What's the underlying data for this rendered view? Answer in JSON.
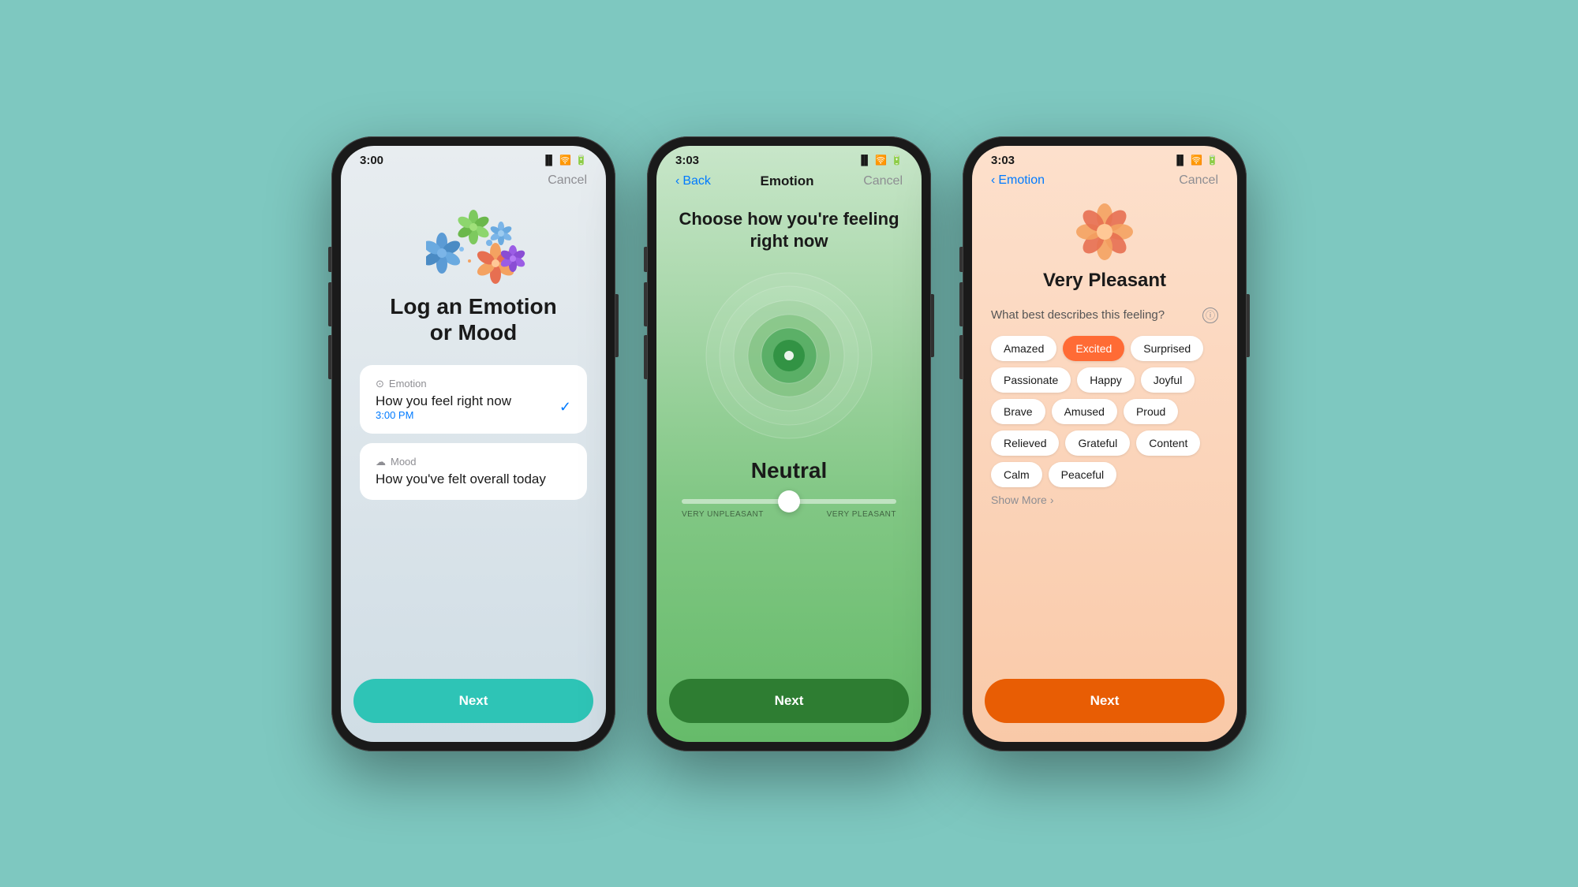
{
  "background": "#7ec8c0",
  "phone1": {
    "status": {
      "time": "3:00",
      "location": "▲",
      "battery": "74"
    },
    "nav": {
      "cancel": "Cancel"
    },
    "flowers": [
      "blue",
      "green",
      "orange-light",
      "blue-light",
      "orange",
      "purple"
    ],
    "title": "Log an Emotion\nor Mood",
    "options": [
      {
        "icon": "⊙",
        "type": "Emotion",
        "description": "How you feel right now",
        "time": "3:00 PM",
        "selected": true
      },
      {
        "icon": "☁",
        "type": "Mood",
        "description": "How you've felt overall today",
        "time": null,
        "selected": false
      }
    ],
    "next_label": "Next"
  },
  "phone2": {
    "status": {
      "time": "3:03",
      "location": "▲",
      "battery": "74"
    },
    "nav": {
      "back": "Back",
      "title": "Emotion",
      "cancel": "Cancel"
    },
    "title": "Choose how you're feeling\nright now",
    "emotion_label": "Neutral",
    "slider": {
      "left_label": "VERY UNPLEASANT",
      "right_label": "VERY PLEASANT",
      "position": 50
    },
    "next_label": "Next"
  },
  "phone3": {
    "status": {
      "time": "3:03",
      "location": "▲",
      "battery": "74"
    },
    "nav": {
      "back": "Emotion",
      "cancel": "Cancel"
    },
    "pleasant_level": "Very Pleasant",
    "describes_label": "What best describes this feeling?",
    "tags": [
      {
        "label": "Amazed",
        "selected": false
      },
      {
        "label": "Excited",
        "selected": true
      },
      {
        "label": "Surprised",
        "selected": false
      },
      {
        "label": "Passionate",
        "selected": false
      },
      {
        "label": "Happy",
        "selected": false
      },
      {
        "label": "Joyful",
        "selected": false
      },
      {
        "label": "Brave",
        "selected": false
      },
      {
        "label": "Amused",
        "selected": false
      },
      {
        "label": "Proud",
        "selected": false
      },
      {
        "label": "Relieved",
        "selected": false
      },
      {
        "label": "Grateful",
        "selected": false
      },
      {
        "label": "Content",
        "selected": false
      },
      {
        "label": "Calm",
        "selected": false
      },
      {
        "label": "Peaceful",
        "selected": false
      }
    ],
    "show_more": "Show More",
    "next_label": "Next"
  }
}
